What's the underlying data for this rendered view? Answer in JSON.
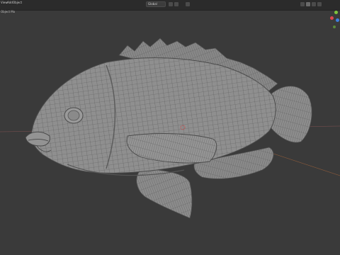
{
  "header": {
    "menus": [
      {
        "name": "menu-view",
        "label": "View"
      },
      {
        "name": "menu-add",
        "label": "Add"
      },
      {
        "name": "menu-object",
        "label": "Object"
      }
    ],
    "mode_label": "Object Mo",
    "transform_orientation": "Global",
    "shading_icons": [
      "wireframe-icon",
      "solid-icon",
      "material-icon",
      "rendered-icon"
    ]
  },
  "gizmo": {
    "x_color": "#e0454f",
    "y_color": "#7fc33c",
    "z_color": "#3d7fe0"
  },
  "colors": {
    "viewport_bg": "#3a3a3a",
    "mesh_fill": "#8c8c8c",
    "wire": "#5b5b5b"
  }
}
